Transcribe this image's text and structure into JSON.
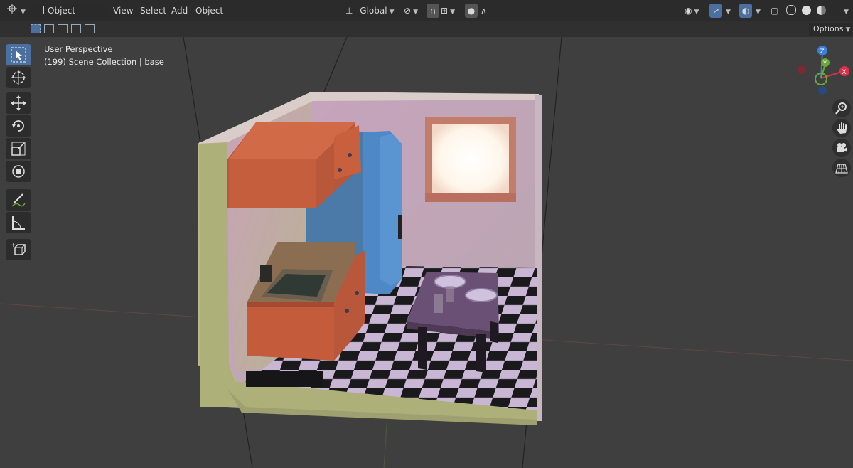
{
  "header": {
    "mode_label": "Object Mode",
    "menu": [
      "View",
      "Select",
      "Add",
      "Object"
    ],
    "transform_orientation": "Global",
    "options_label": "Options"
  },
  "viewport": {
    "perspective_label": "User Perspective",
    "collection_label": "(199) Scene Collection | base"
  },
  "gizmo": {
    "z": "Z",
    "y": "Y",
    "x": "X"
  },
  "icons": {
    "toolbar": [
      "select-box-icon",
      "cursor-icon",
      "move-icon",
      "rotate-icon",
      "scale-icon",
      "transform-icon",
      "annotate-icon",
      "measure-icon",
      "add-cube-icon"
    ],
    "nav": [
      "zoom-icon",
      "hand-pan-icon",
      "camera-icon",
      "grid-icon"
    ]
  },
  "colors": {
    "accent": "#4b6f9f",
    "x_axis": "#d6334a",
    "y_axis": "#6aa83a",
    "z_axis": "#3b7fd8"
  }
}
